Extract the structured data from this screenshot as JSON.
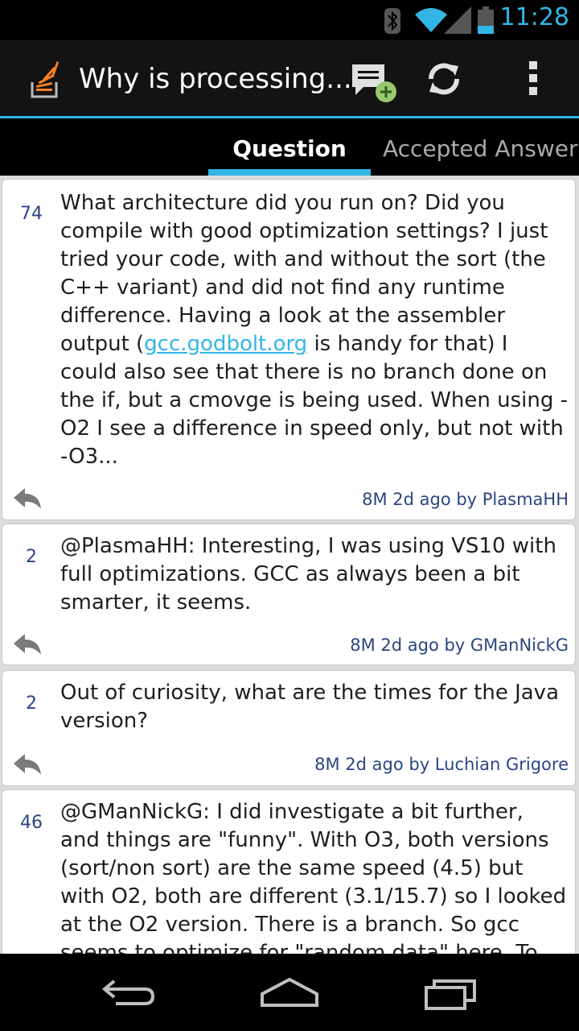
{
  "status_bar": {
    "time": "11:28",
    "icons": [
      "bluetooth-icon",
      "wifi-icon",
      "signal-icon",
      "battery-icon"
    ]
  },
  "action_bar": {
    "title": "Why is processing...",
    "actions": [
      "compose-comment-icon",
      "refresh-icon",
      "overflow-menu-icon"
    ]
  },
  "tabs": [
    {
      "label": "Question",
      "selected": true
    },
    {
      "label": "Accepted Answer",
      "selected": false
    }
  ],
  "comments": [
    {
      "score": "74",
      "text_before_link": "What architecture did you run on? Did you compile with good optimization settings? I just tried your code, with and without the sort (the C++ variant) and did not find any runtime difference. Having a look at the assembler output (",
      "link": "gcc.godbolt.org",
      "text_after_link": " is handy for that) I could also see that there is no branch done on the if, but a cmovge is being used. When using -O2 I see a difference in speed only, but not with -O3...",
      "meta": "8M 2d ago by PlasmaHH"
    },
    {
      "score": "2",
      "text": "@PlasmaHH: Interesting, I was using VS10 with full optimizations. GCC as always been a bit smarter, it seems.",
      "meta": "8M 2d ago by GManNickG"
    },
    {
      "score": "2",
      "text": "Out of curiosity, what are the times for the Java version?",
      "meta": "8M 2d ago by Luchian Grigore"
    },
    {
      "score": "46",
      "text": "@GManNickG: I did investigate a bit further, and things are \"funny\". With O3, both versions (sort/non sort) are the same speed (4.5) but with O2, both are different (3.1/15.7) so I looked at the O2 version. There is a branch. So gcc seems to optimize for \"random data\" here. To",
      "meta": ""
    }
  ],
  "nav_bar": {
    "buttons": [
      "back-icon",
      "home-icon",
      "recent-apps-icon"
    ]
  },
  "colors": {
    "accent": "#33b5e5",
    "score_text": "#2b4580",
    "actionbar_bg": "#131313"
  }
}
